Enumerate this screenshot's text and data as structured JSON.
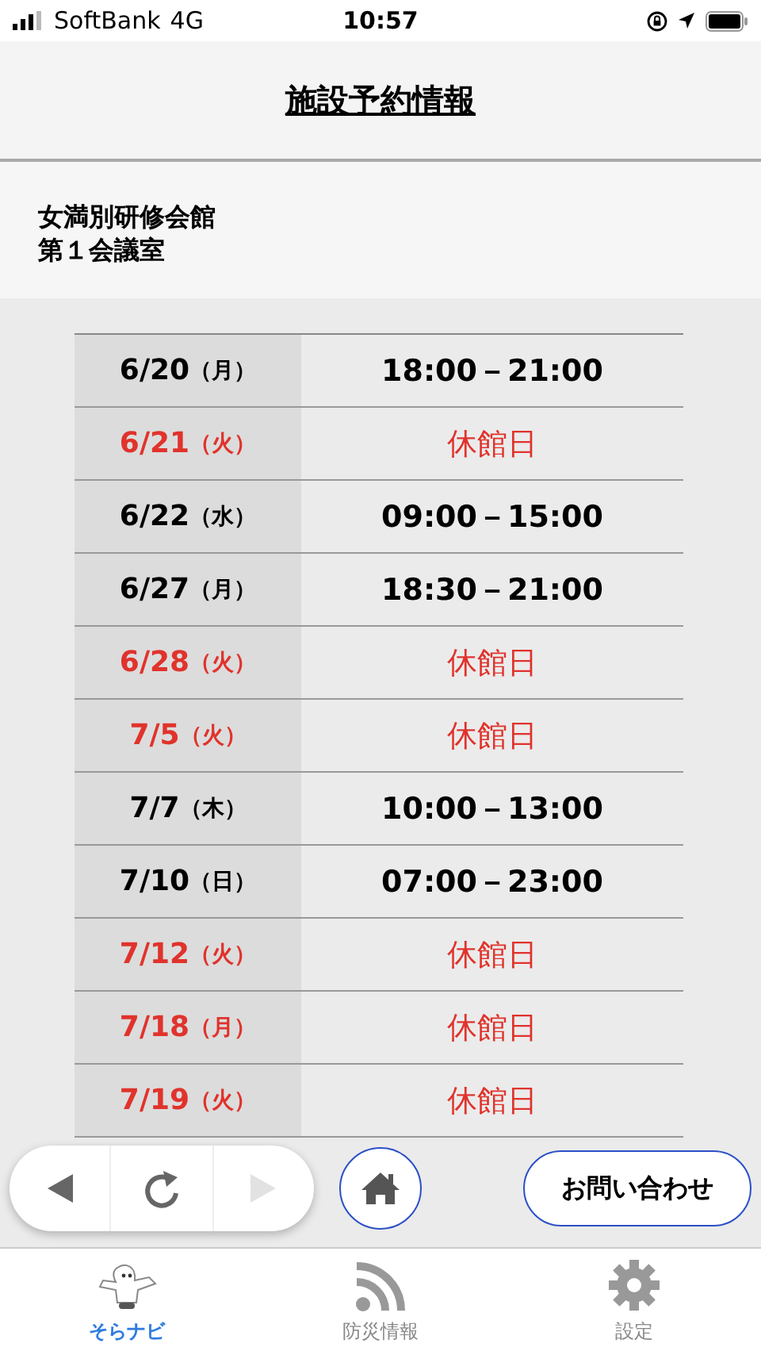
{
  "status_bar": {
    "carrier": "SoftBank",
    "network": "4G",
    "time": "10:57"
  },
  "header": {
    "title": "施設予約情報"
  },
  "facility": {
    "name": "女満別研修会館",
    "room": "第１会議室"
  },
  "schedule": [
    {
      "date": "6/20",
      "weekday": "（月）",
      "kind": "open",
      "time": "18:00－21:00"
    },
    {
      "date": "6/21",
      "weekday": "（火）",
      "kind": "closed",
      "time": "休館日"
    },
    {
      "date": "6/22",
      "weekday": "（水）",
      "kind": "open",
      "time": "09:00－15:00"
    },
    {
      "date": "6/27",
      "weekday": "（月）",
      "kind": "open",
      "time": "18:30－21:00"
    },
    {
      "date": "6/28",
      "weekday": "（火）",
      "kind": "closed",
      "time": "休館日"
    },
    {
      "date": "7/5",
      "weekday": "（火）",
      "kind": "closed",
      "time": "休館日"
    },
    {
      "date": "7/7",
      "weekday": "（木）",
      "kind": "open",
      "time": "10:00－13:00"
    },
    {
      "date": "7/10",
      "weekday": "（日）",
      "kind": "open",
      "time": "07:00－23:00"
    },
    {
      "date": "7/12",
      "weekday": "（火）",
      "kind": "closed",
      "time": "休館日"
    },
    {
      "date": "7/18",
      "weekday": "（月）",
      "kind": "closed",
      "time": "休館日"
    },
    {
      "date": "7/19",
      "weekday": "（火）",
      "kind": "closed",
      "time": "休館日"
    }
  ],
  "toolbar": {
    "contact_button": "お問い合わせ"
  },
  "tabs": [
    {
      "label": "そらナビ",
      "selected": true
    },
    {
      "label": "防災情報",
      "selected": false
    },
    {
      "label": "設定",
      "selected": false
    }
  ]
}
